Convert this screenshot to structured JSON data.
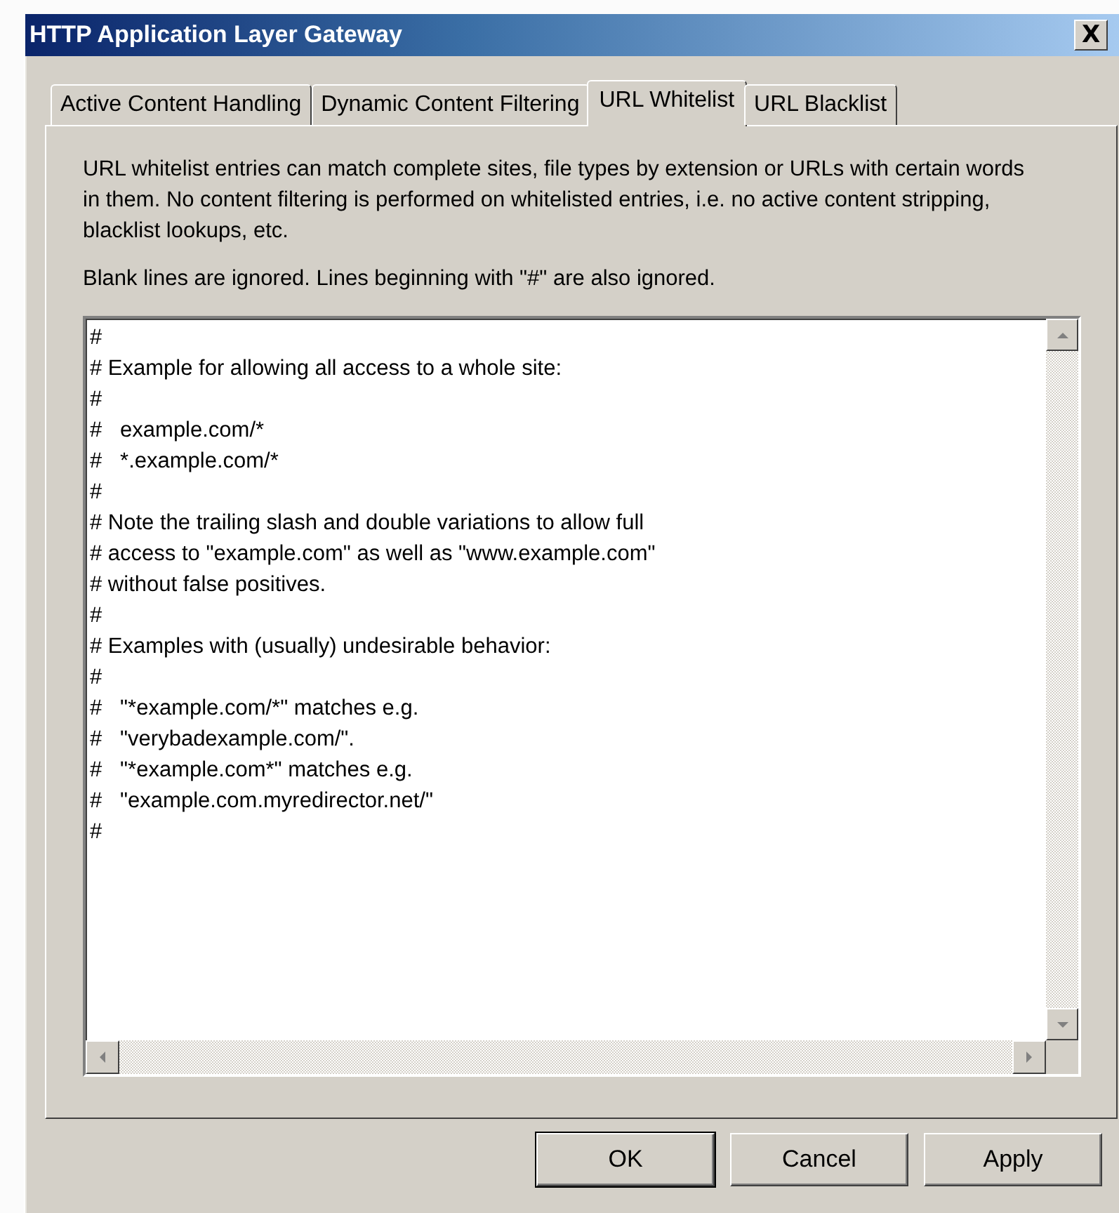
{
  "window": {
    "title": "HTTP Application Layer Gateway",
    "close": "X"
  },
  "tabs": [
    {
      "label": "Active Content Handling",
      "selected": false
    },
    {
      "label": "Dynamic Content Filtering",
      "selected": false
    },
    {
      "label": "URL Whitelist",
      "selected": true
    },
    {
      "label": "URL Blacklist",
      "selected": false
    }
  ],
  "description": [
    "URL whitelist entries can match complete sites, file types by extension or URLs with certain words in them.  No content filtering is performed on whitelisted entries, i.e. no active content stripping, blacklist lookups, etc.",
    "Blank lines are ignored. Lines beginning with \"#\" are also ignored."
  ],
  "editor": {
    "lines": [
      "#",
      "# Example for allowing all access to a whole site:",
      "#",
      "#   example.com/*",
      "#   *.example.com/*",
      "#",
      "# Note the trailing slash and double variations to allow full",
      "# access to \"example.com\" as well as \"www.example.com\"",
      "# without false positives.",
      "#",
      "# Examples with (usually) undesirable behavior:",
      "#",
      "#   \"*example.com/*\" matches e.g.",
      "#   \"verybadexample.com/\".",
      "#   \"*example.com*\" matches e.g.",
      "#   \"example.com.myredirector.net/\"",
      "#"
    ]
  },
  "buttons": [
    {
      "label": "OK",
      "default": true
    },
    {
      "label": "Cancel",
      "default": false
    },
    {
      "label": "Apply",
      "default": false
    }
  ]
}
